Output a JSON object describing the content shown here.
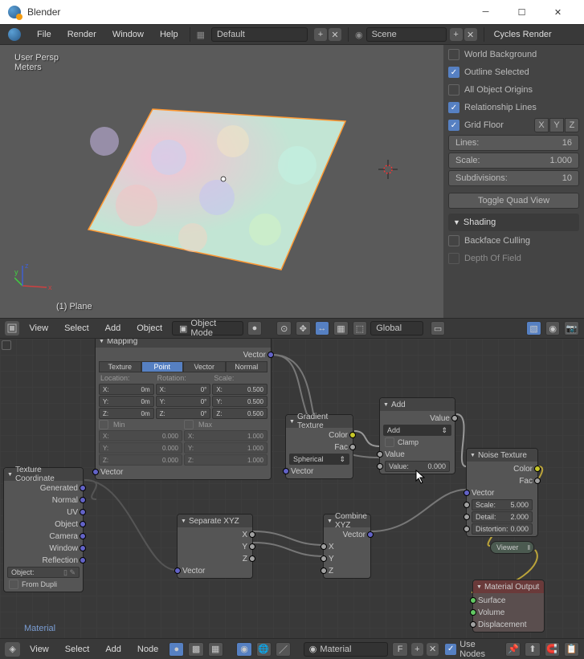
{
  "app": {
    "title": "Blender"
  },
  "topmenu": {
    "file": "File",
    "render": "Render",
    "window": "Window",
    "help": "Help",
    "layout": "Default",
    "scene_label": "Scene",
    "renderer": "Cycles Render"
  },
  "viewport": {
    "persp": "User Persp",
    "units": "Meters",
    "selected": "(1) Plane",
    "menus": {
      "view": "View",
      "select": "Select",
      "add": "Add",
      "object": "Object"
    },
    "mode": "Object Mode",
    "orientation": "Global"
  },
  "rightpanel": {
    "world_background": "World Background",
    "outline_selected": "Outline Selected",
    "all_origins": "All Object Origins",
    "relationship_lines": "Relationship Lines",
    "grid_floor": "Grid Floor",
    "axes": [
      "X",
      "Y",
      "Z"
    ],
    "lines": {
      "label": "Lines:",
      "value": "16"
    },
    "scale": {
      "label": "Scale:",
      "value": "1.000"
    },
    "subdivisions": {
      "label": "Subdivisions:",
      "value": "10"
    },
    "toggle_quad": "Toggle Quad View",
    "shading_header": "Shading",
    "backface": "Backface Culling",
    "depth_of_field": "Depth Of Field"
  },
  "node_editor": {
    "material_active": "Material",
    "menus": {
      "view": "View",
      "select": "Select",
      "add": "Add",
      "node": "Node"
    },
    "material_field": "Material",
    "use_nodes": "Use Nodes",
    "f_flag": "F"
  },
  "nodes": {
    "tex_coord": {
      "title": "Texture Coordinate",
      "outputs": [
        "Generated",
        "Normal",
        "UV",
        "Object",
        "Camera",
        "Window",
        "Reflection"
      ],
      "object_label": "Object:",
      "from_dupli": "From Dupli"
    },
    "mapping": {
      "title": "Mapping",
      "out": "Vector",
      "tabs": [
        "Texture",
        "Point",
        "Vector",
        "Normal"
      ],
      "loc": "Location:",
      "rot": "Rotation:",
      "scl": "Scale:",
      "loc_vals": [
        [
          "X:",
          "0m"
        ],
        [
          "Y:",
          "0m"
        ],
        [
          "Z:",
          "0m"
        ]
      ],
      "rot_vals": [
        [
          "X:",
          "0°"
        ],
        [
          "Y:",
          "0°"
        ],
        [
          "Z:",
          "0°"
        ]
      ],
      "scl_vals": [
        [
          "X:",
          "0.500"
        ],
        [
          "Y:",
          "0.500"
        ],
        [
          "Z:",
          "0.500"
        ]
      ],
      "min": "Min",
      "max": "Max",
      "min_vals": [
        [
          "X:",
          "0.000"
        ],
        [
          "Y:",
          "0.000"
        ],
        [
          "Z:",
          "0.000"
        ]
      ],
      "max_vals": [
        [
          "X:",
          "1.000"
        ],
        [
          "Y:",
          "1.000"
        ],
        [
          "Z:",
          "1.000"
        ]
      ],
      "in": "Vector"
    },
    "sep_xyz": {
      "title": "Separate XYZ",
      "outs": [
        "X",
        "Y",
        "Z"
      ],
      "in": "Vector"
    },
    "gradient": {
      "title": "Gradient Texture",
      "outs": [
        "Color",
        "Fac"
      ],
      "type": "Spherical",
      "in": "Vector"
    },
    "combine": {
      "title": "Combine XYZ",
      "out": "Vector",
      "ins": [
        "X",
        "Y",
        "Z"
      ]
    },
    "add": {
      "title": "Add",
      "out": "Value",
      "op": "Add",
      "clamp": "Clamp",
      "in1": "Value",
      "in2": {
        "label": "Value:",
        "value": "0.000"
      }
    },
    "noise": {
      "title": "Noise Texture",
      "outs": [
        "Color",
        "Fac"
      ],
      "in_vector": "Vector",
      "scale": {
        "label": "Scale:",
        "value": "5.000"
      },
      "detail": {
        "label": "Detail:",
        "value": "2.000"
      },
      "distortion": {
        "label": "Distortion:",
        "value": "0.000"
      }
    },
    "viewer": {
      "title": "Viewer"
    },
    "mat_output": {
      "title": "Material Output",
      "ins": [
        "Surface",
        "Volume",
        "Displacement"
      ]
    }
  }
}
